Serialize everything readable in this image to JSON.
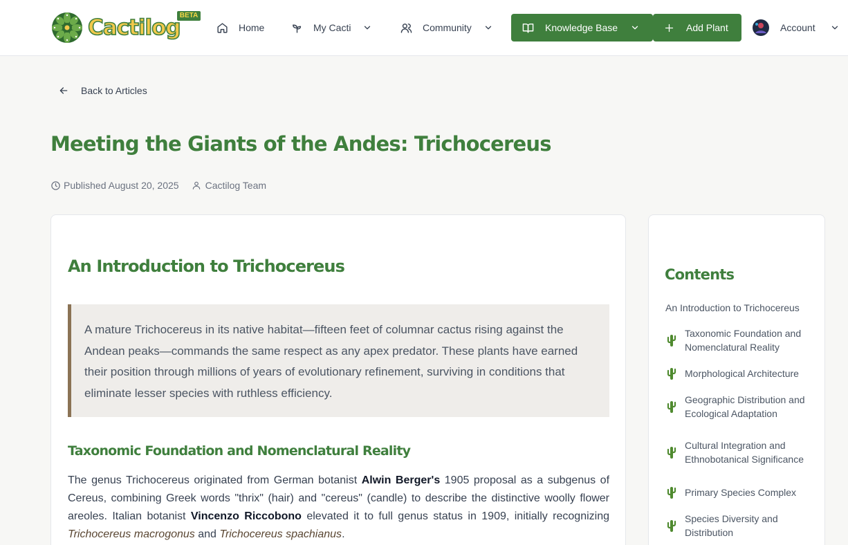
{
  "header": {
    "logo_text": "Cactilog",
    "badge": "BETA",
    "nav": {
      "home": "Home",
      "my_cacti": "My Cacti",
      "community": "Community",
      "knowledge_base": "Knowledge Base",
      "add_plant": "Add Plant",
      "account": "Account"
    }
  },
  "back_link": "Back to Articles",
  "article": {
    "title": "Meeting the Giants of the Andes: Trichocereus",
    "published": "Published August 20, 2025",
    "author": "Cactilog Team",
    "intro_heading": "An Introduction to Trichocereus",
    "blockquote": "A mature Trichocereus in its native habitat—fifteen feet of columnar cactus rising against the Andean peaks—commands the same respect as any apex predator. These plants have earned their position through millions of years of evolutionary refinement, surviving in conditions that eliminate lesser species with ruthless efficiency.",
    "section_heading": "Taxonomic Foundation and Nomenclatural Reality",
    "paragraph": {
      "t1": "The genus Trichocereus originated from German botanist ",
      "b1": "Alwin Berger's",
      "t2": " 1905 proposal as a subgenus of Cereus, combining Greek words \"thrix\" (hair) and \"cereus\" (candle) to describe the distinctive woolly flower areoles. Italian botanist ",
      "b2": "Vincenzo Riccobono",
      "t3": " elevated it to full genus status in 1909, initially recognizing ",
      "i1": "Trichocereus macrogonus",
      "t4": " and ",
      "i2": "Trichocereus spachianus",
      "t5": "."
    }
  },
  "contents": {
    "title": "Contents",
    "intro": "An Introduction to Trichocereus",
    "items": [
      {
        "label": "Taxonomic Foundation and Nomenclatural Reality"
      },
      {
        "label": "Morphological Architecture"
      },
      {
        "label": "Geographic Distribution and Ecological Adaptation"
      },
      {
        "label": "Cultural Integration and Ethnobotanical Significance"
      },
      {
        "label": "Primary Species Complex"
      },
      {
        "label": "Species Diversity and Distribution"
      }
    ]
  },
  "colors": {
    "brand_green": "#3f7f3d",
    "logo_yellow": "#f2c94c",
    "quote_border": "#8b7355",
    "quote_bg": "#efedea"
  },
  "icons": [
    "home-icon",
    "sprout-icon",
    "users-icon",
    "book-icon",
    "plus-icon",
    "chevron-down-icon",
    "arrow-left-icon",
    "clock-icon",
    "user-icon",
    "cactus-icon"
  ]
}
